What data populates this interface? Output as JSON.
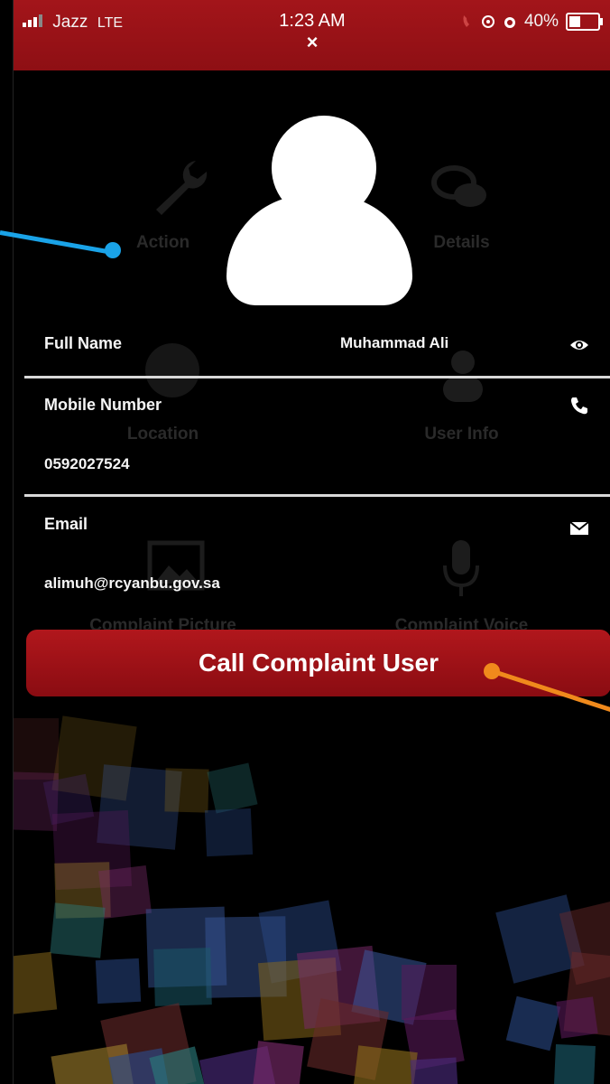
{
  "status_bar": {
    "carrier": "Jazz",
    "network": "LTE",
    "time": "1:23 AM",
    "close_glyph": "×",
    "battery_percent": "40%",
    "battery_level": 0.4
  },
  "background_grid": {
    "items": [
      "Action",
      "Details",
      "Location",
      "User Info",
      "Complaint Picture",
      "Complaint Voice"
    ]
  },
  "fields": {
    "full_name": {
      "label": "Full Name",
      "value": "Muhammad Ali",
      "icon": "eye-icon"
    },
    "mobile": {
      "label": "Mobile Number",
      "value": "0592027524",
      "icon": "phone-icon"
    },
    "email": {
      "label": "Email",
      "value": "alimuh@rcyanbu.gov.sa",
      "icon": "envelope-icon"
    }
  },
  "actions": {
    "call_label": "Call Complaint User"
  },
  "colors": {
    "header_red": "#a3151a",
    "button_red": "#9e1217",
    "annotation_blue": "#1aa3e8",
    "annotation_orange": "#f08a1c"
  }
}
